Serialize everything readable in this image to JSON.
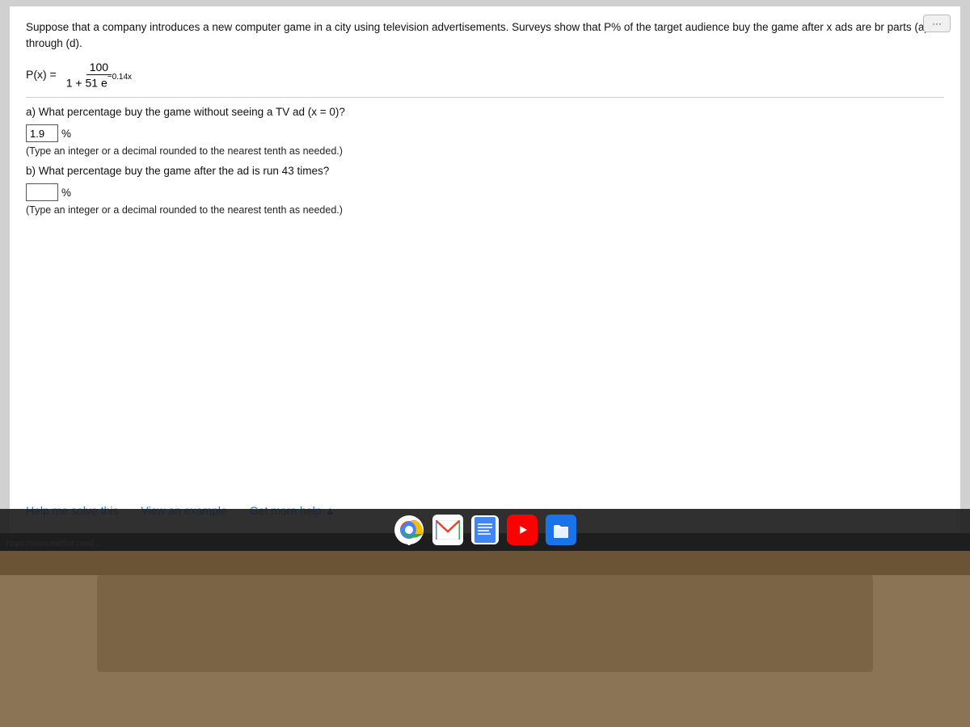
{
  "screen": {
    "background": "#d0d0d0"
  },
  "problem": {
    "intro_text": "Suppose that a company introduces a new computer game in a city using television advertisements. Surveys show that P% of the target audience buy the game after x ads are br parts (a) through (d).",
    "formula_label": "P(x) =",
    "numerator": "100",
    "denominator_base": "1 + 51 e",
    "denominator_exp": "−0.14x",
    "more_button_label": "···",
    "part_a": {
      "question": "a) What percentage buy the game without seeing a TV ad (x = 0)?",
      "answer_value": "1.9",
      "answer_suffix": "%",
      "instruction": "(Type an integer or a decimal rounded to the nearest tenth as needed.)"
    },
    "part_b": {
      "question": "b) What percentage buy the game after the ad is run 43 times?",
      "answer_value": "",
      "answer_suffix": "%",
      "instruction": "(Type an integer or a decimal rounded to the nearest tenth as needed.)"
    },
    "buttons": {
      "help": "Help me solve this",
      "example": "View an example",
      "more_help": "Get more help ▲"
    }
  },
  "taskbar": {
    "icons": [
      {
        "name": "chrome",
        "label": "Chrome",
        "color": "#e0e0e0"
      },
      {
        "name": "gmail",
        "label": "Gmail",
        "color": "#e0e0e0"
      },
      {
        "name": "docs",
        "label": "Docs",
        "color": "#e0e0e0"
      },
      {
        "name": "youtube",
        "label": "YouTube",
        "color": "#e0e0e0"
      },
      {
        "name": "files",
        "label": "Files",
        "color": "#e0e0e0"
      }
    ]
  },
  "url": {
    "text": "https://www.mathxl.com/..."
  }
}
